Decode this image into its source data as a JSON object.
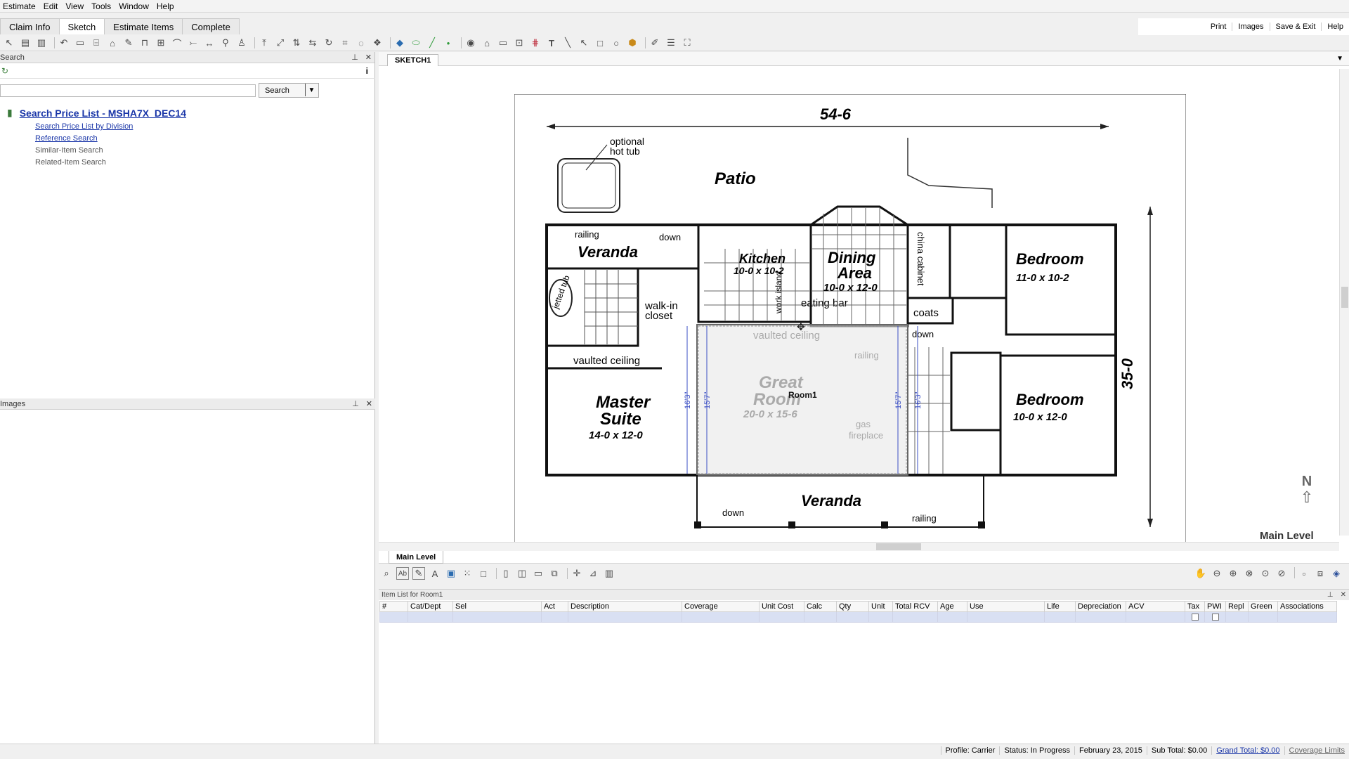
{
  "menu": [
    "Estimate",
    "Edit",
    "View",
    "Tools",
    "Window",
    "Help"
  ],
  "tabs": [
    {
      "label": "Claim Info",
      "active": false
    },
    {
      "label": "Sketch",
      "active": true
    },
    {
      "label": "Estimate Items",
      "active": false
    },
    {
      "label": "Complete",
      "active": false
    }
  ],
  "toplinks": [
    "Print",
    "Images",
    "Save & Exit",
    "Help"
  ],
  "search_panel": {
    "title": "Search",
    "search_button": "Search",
    "main_link": "Search Price List - MSHA7X_DEC14",
    "links": [
      "Search Price List by Division",
      "Reference Search"
    ],
    "disabled": [
      "Similar-Item Search",
      "Related-Item Search"
    ]
  },
  "images_panel": {
    "title": "Images"
  },
  "sketch": {
    "tab": "SKETCH1",
    "level_tab": "Main Level",
    "level_label": "Main Level",
    "compass_letter": "N",
    "plan": {
      "width_dim": "54-6",
      "depth_dim": "35-0",
      "patio": "Patio",
      "hot_tub": [
        "optional",
        "hot tub"
      ],
      "veranda_top": "Veranda",
      "veranda_bottom": "Veranda",
      "railing": "railing",
      "down": "down",
      "kitchen": [
        "Kitchen",
        "10-0 x 10-2"
      ],
      "dining": [
        "Dining",
        "Area",
        "10-0 x 12-0"
      ],
      "bedroom1": [
        "Bedroom",
        "11-0 x 10-2"
      ],
      "bedroom2": [
        "Bedroom",
        "10-0 x 12-0"
      ],
      "master": [
        "Master",
        "Suite",
        "14-0 x 12-0"
      ],
      "great": [
        "Great",
        "Room",
        "20-0 x 15-6"
      ],
      "room_label": "Room1",
      "china": "china cabinet",
      "eating_bar": "eating bar",
      "work_island": "work island",
      "walkin": [
        "walk-in",
        "closet"
      ],
      "vaulted": "vaulted ceiling",
      "coats": "coats",
      "jetted": "jetted tub",
      "gas_fp": [
        "gas",
        "fireplace"
      ],
      "dim_left": "16'3\"",
      "dim_left2": "15'7\"",
      "dim_right": "15'7\"",
      "dim_right2": "16'3\""
    }
  },
  "item_list": {
    "title": "Item List for Room1",
    "columns": [
      "#",
      "Cat/Dept",
      "Sel",
      "Act",
      "Description",
      "Coverage",
      "Unit Cost",
      "Calc",
      "Qty",
      "Unit",
      "Total RCV",
      "Age",
      "Use",
      "Life",
      "Depreciation",
      "ACV",
      "Tax",
      "PWI",
      "Repl",
      "Green",
      "Associations"
    ]
  },
  "status": {
    "profile": "Profile:  Carrier",
    "status": "Status:  In Progress",
    "date": "February 23, 2015",
    "subtotal": "Sub Total: $0.00",
    "grandtotal": "Grand Total: $0.00",
    "coverage": "Coverage Limits"
  }
}
